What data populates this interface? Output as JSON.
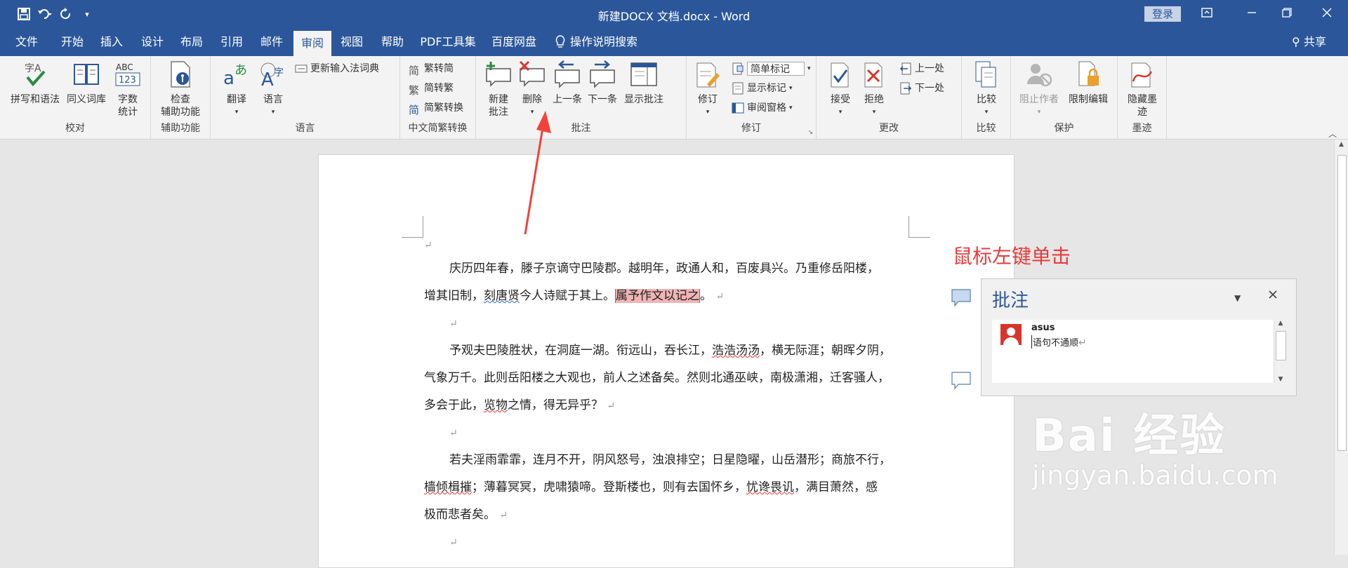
{
  "window": {
    "title": "新建DOCX 文档.docx - Word",
    "login_label": "登录",
    "share_label": "共享"
  },
  "tabs": [
    {
      "label": "文件"
    },
    {
      "label": "开始"
    },
    {
      "label": "插入"
    },
    {
      "label": "设计"
    },
    {
      "label": "布局"
    },
    {
      "label": "引用"
    },
    {
      "label": "邮件"
    },
    {
      "label": "审阅",
      "active": true
    },
    {
      "label": "视图"
    },
    {
      "label": "帮助"
    },
    {
      "label": "PDF工具集"
    },
    {
      "label": "百度网盘"
    },
    {
      "label": "操作说明搜索"
    }
  ],
  "ribbon": {
    "proofing": {
      "label": "校对",
      "spelling": "拼写和语法",
      "thesaurus": "同义词库",
      "word_count_1": "字数",
      "word_count_2": "统计"
    },
    "accessibility": {
      "label": "辅助功能",
      "check_1": "检查",
      "check_2": "辅助功能"
    },
    "language": {
      "label": "语言",
      "translate": "翻译",
      "language": "语言",
      "update_ime": "更新输入法词典"
    },
    "chinese": {
      "label": "中文简繁转换",
      "to_simplified": "繁转简",
      "to_traditional": "简转繁",
      "convert": "简繁转换"
    },
    "comments": {
      "label": "批注",
      "new_1": "新建",
      "new_2": "批注",
      "delete": "删除",
      "previous": "上一条",
      "next": "下一条",
      "show": "显示批注"
    },
    "tracking": {
      "label": "修订",
      "track": "修订",
      "markup_combo": "简单标记",
      "show_markup": "显示标记",
      "review_pane": "审阅窗格"
    },
    "changes": {
      "label": "更改",
      "accept": "接受",
      "reject": "拒绝",
      "previous": "上一处",
      "next": "下一处"
    },
    "compare": {
      "label": "比较",
      "compare": "比较"
    },
    "protect": {
      "label": "保护",
      "block_authors": "阻止作者",
      "restrict": "限制编辑"
    },
    "ink": {
      "label": "墨迹",
      "hide_ink_1": "隐藏墨",
      "hide_ink_2": "迹"
    }
  },
  "document": {
    "p1_line1": "庆历四年春，滕子京谪守巴陵郡。越明年，政通人和，百废具兴。乃重修岳阳楼，",
    "p1_line2_a": "增其旧制，",
    "p1_line2_b": "刻唐贤",
    "p1_line2_c": "今人诗赋于其上。",
    "p1_line2_hl": "属予作文以记之",
    "p1_line2_d": "。",
    "p2_line1_a": "予观夫巴陵胜状，在洞庭一湖。衔远山，吞长江，",
    "p2_line1_b": "浩浩汤汤",
    "p2_line1_c": "，横无际涯；朝晖夕阴，",
    "p2_line2": "气象万千。此则岳阳楼之大观也，前人之述备矣。然则北通巫峡，南极潇湘，迁客骚人，",
    "p2_line3_a": "多会于此，",
    "p2_line3_b": "览物",
    "p2_line3_c": "之情，得无异乎？",
    "p3_line1": "若夫淫雨霏霏，连月不开，阴风怒号，浊浪排空；日星隐曜，山岳潜形；商旅不行，",
    "p3_line2_a": "樯倾楫摧",
    "p3_line2_b": "；薄暮冥冥，虎啸猿啼。登斯楼也，则有去国怀乡，",
    "p3_line2_c": "忧谗畏讥",
    "p3_line2_d": "，满目萧然，感",
    "p3_line3": "极而悲者矣。",
    "pilcrow": "↵"
  },
  "annotation": {
    "text": "鼠标左键单击"
  },
  "comment_pane": {
    "title": "批注",
    "author": "asus",
    "text": "语句不通顺"
  },
  "watermark": {
    "text": "Bai 经验",
    "url": "jingyan.baidu.com"
  },
  "colors": {
    "brand": "#2b579a",
    "highlight": "#f0b4b4",
    "annotation": "#ea3a3a"
  }
}
